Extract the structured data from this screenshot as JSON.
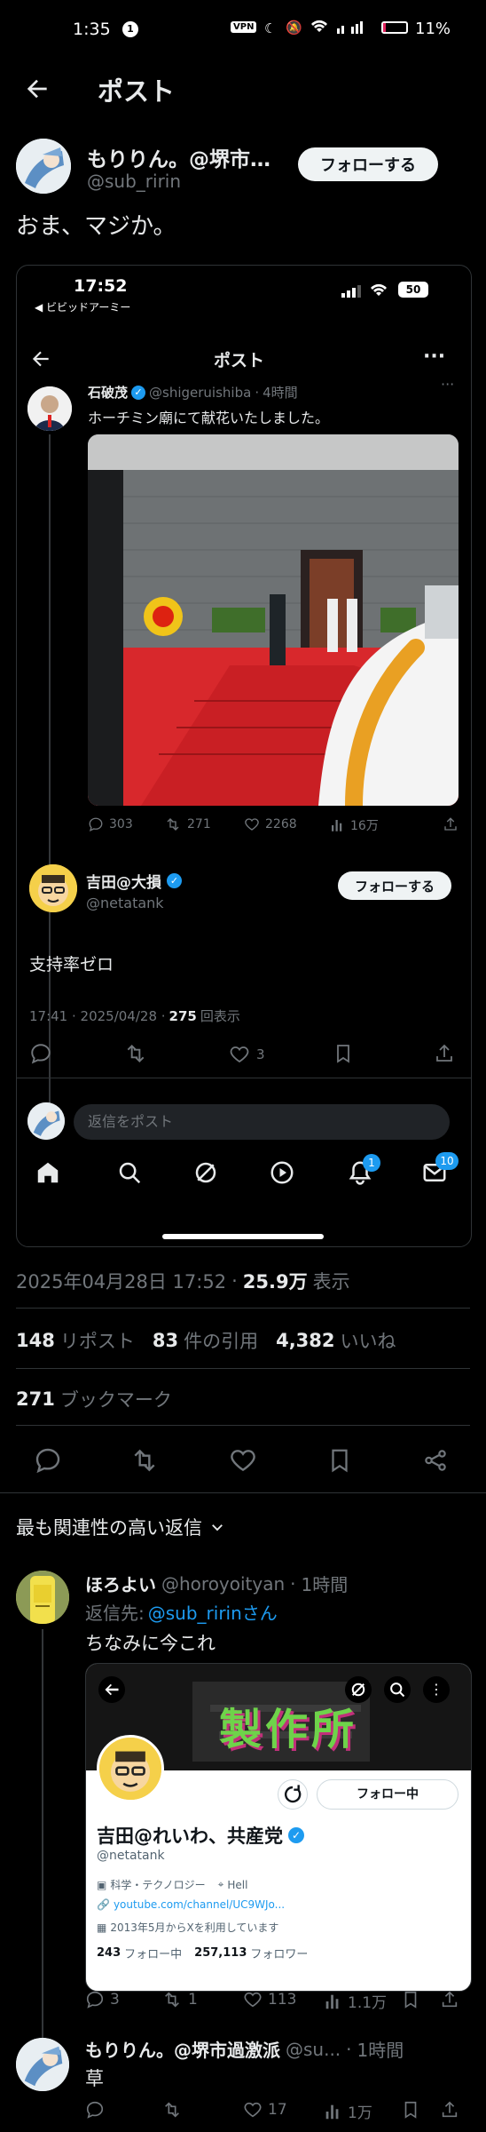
{
  "status_bar": {
    "time": "1:35",
    "notif_count": "1",
    "vpn": "VPN",
    "battery": "11%"
  },
  "header": {
    "title": "ポスト"
  },
  "post": {
    "author_name": "もりりん。@堺市…",
    "handle": "@sub_ririn",
    "follow_label": "フォローする",
    "text": "おま、マジか。",
    "timestamp": "2025年04月28日 17:52",
    "views_num": "25.9万",
    "views_label": "表示",
    "reposts_num": "148",
    "reposts_label": "リポスト",
    "quotes_num": "83",
    "quotes_label": "件の引用",
    "likes_num": "4,382",
    "likes_label": "いいね",
    "bookmarks_num": "271",
    "bookmarks_label": "ブックマーク"
  },
  "embed": {
    "status_time": "17:52",
    "status_back": "◀ ビビッドアーミー",
    "battery": "50",
    "header_title": "ポスト",
    "quoted": {
      "author": "石破茂",
      "handle": "@shigeruishiba",
      "age": "4時間",
      "text": "ホーチミン廟にて献花いたしました。",
      "replies": "303",
      "reposts": "271",
      "likes": "2268",
      "views": "16万"
    },
    "main": {
      "author": "吉田@大損",
      "handle": "@netatank",
      "follow_label": "フォローする",
      "text": "支持率ゼロ",
      "meta_time": "17:41 · 2025/04/28 ·",
      "meta_views": "275",
      "meta_views_label": "回表示",
      "likes": "3"
    },
    "reply_placeholder": "返信をポスト",
    "notif_badge": "1",
    "mail_badge": "10"
  },
  "replies_filter": "最も関連性の高い返信",
  "reply1": {
    "author": "ほろよい",
    "handle": "@horoyoityan",
    "age": "1時間",
    "reply_to_prefix": "返信先:",
    "reply_to_handle": "@sub_ririnさん",
    "text": "ちなみに今これ",
    "profile": {
      "name": "吉田@れいわ、共産党",
      "handle": "@netatank",
      "follow_label": "フォロー中",
      "category": "科学・テクノロジー",
      "location": "Hell",
      "url": "youtube.com/channel/UC9WJo...",
      "joined": "2013年5月からXを利用しています",
      "following_num": "243",
      "following_label": "フォロー中",
      "followers_num": "257,113",
      "followers_label": "フォロワー",
      "banner_text": "製作所"
    },
    "replies": "3",
    "reposts": "1",
    "likes": "113",
    "views": "1.1万"
  },
  "reply2": {
    "author": "もりりん。@堺市過激派",
    "handle": "@su...",
    "age": "1時間",
    "text": "草",
    "likes": "17",
    "views": "1万"
  }
}
